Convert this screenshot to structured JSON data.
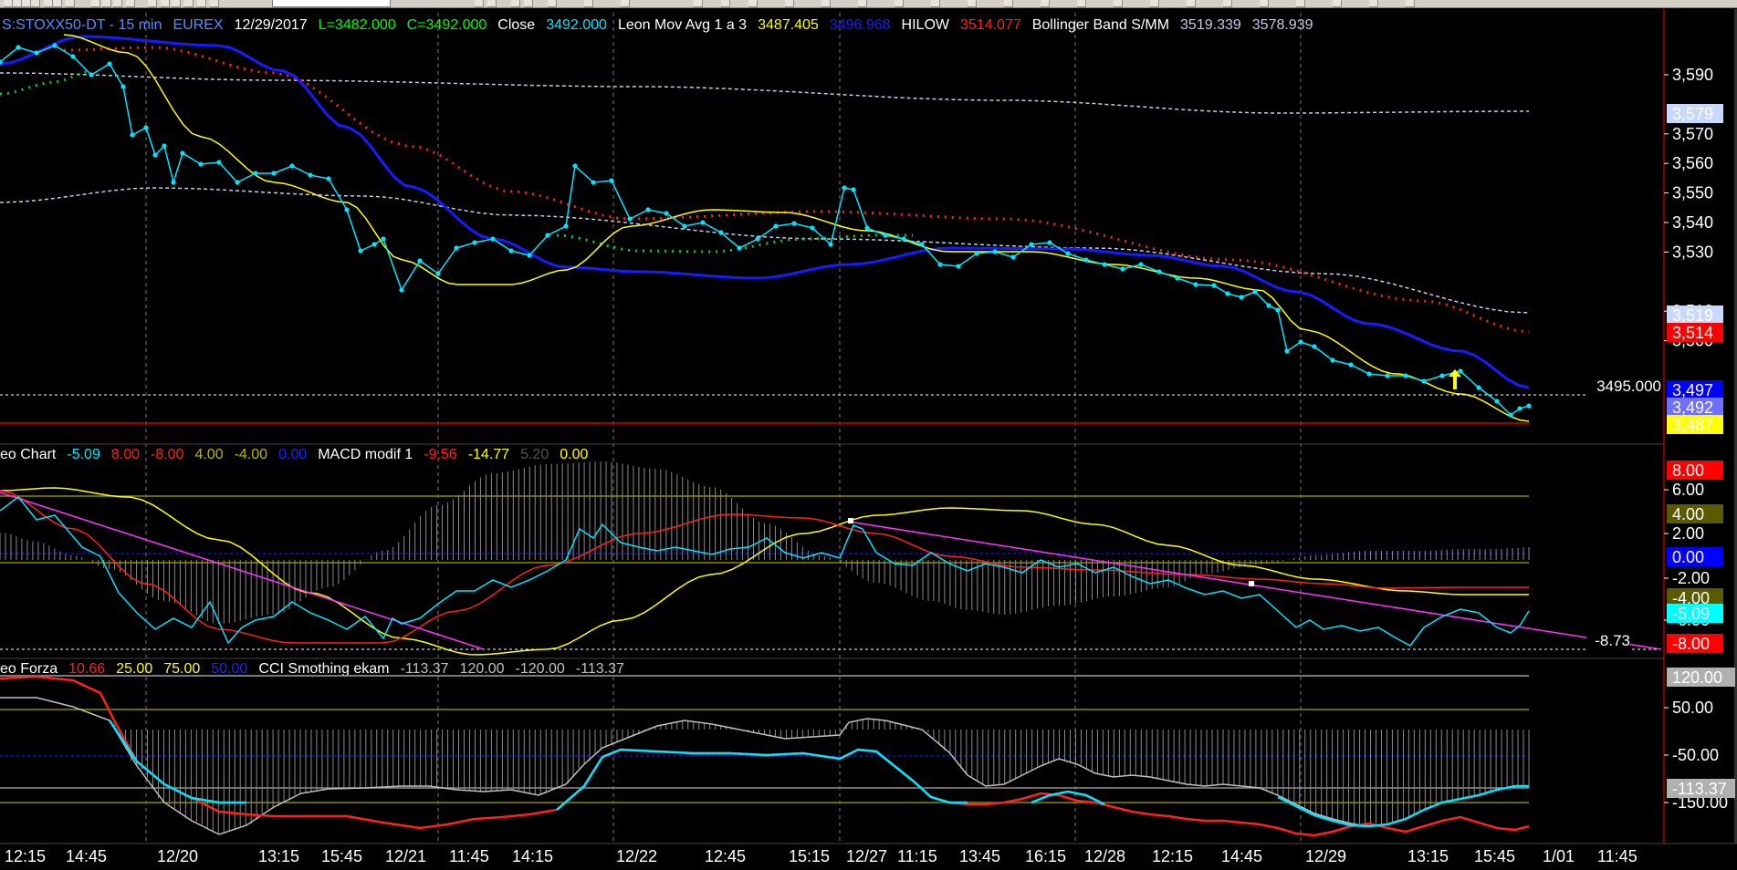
{
  "colors": {
    "background": "#000000",
    "price": "#00e5ff",
    "leon_avg": "#ffff00",
    "hilow": "#1a1aff",
    "bollinger_mid": "#ff2020",
    "bollinger_band": "#c8c8e8",
    "green_dots": "#00cc44",
    "macd_red": "#ff2020",
    "magenta": "#ff33ff",
    "histogram": "#8a8a8a",
    "cci_red": "#ff2020",
    "cci_cyan": "#00e5ff",
    "gray_line": "#c0c0c0"
  },
  "toolbar": {
    "icons": [
      "new-icon",
      "open-icon",
      "save-icon",
      "print-icon",
      "cut-icon",
      "copy-icon",
      "paste-icon",
      "chart-icon",
      "zoom-in-icon",
      "zoom-out-icon",
      "cursor-icon",
      "crosshair-icon",
      "trendline-icon",
      "text-icon"
    ]
  },
  "panel1": {
    "header": [
      {
        "text": "S:STOXX50-DT - 15 min",
        "color": "#5a8cff"
      },
      {
        "text": "EUREX",
        "color": "#5a8cff"
      },
      {
        "text": "12/29/2017",
        "color": "#ffffff"
      },
      {
        "text": "L=3482.000",
        "color": "#00ff00"
      },
      {
        "text": "C=3492.000",
        "color": "#00ff00"
      },
      {
        "text": "Close",
        "color": "#ffffff"
      },
      {
        "text": "3492.000",
        "color": "#00e5ff"
      },
      {
        "text": "Leon Mov Avg 1 a 3",
        "color": "#ffffff"
      },
      {
        "text": "3487.405",
        "color": "#ffff00"
      },
      {
        "text": "3496.968",
        "color": "#1a1aff"
      },
      {
        "text": "HILOW",
        "color": "#ffffff"
      },
      {
        "text": "3514.077",
        "color": "#ff2020"
      },
      {
        "text": "Bollinger Band S/MM",
        "color": "#ffffff"
      },
      {
        "text": "3519.339",
        "color": "#c8c8e8"
      },
      {
        "text": "3578.939",
        "color": "#c8c8e8"
      }
    ],
    "y_ticks": [
      "3,590",
      "3,570",
      "3,560",
      "3,550",
      "3,540",
      "3,530",
      "3,510",
      "3,500"
    ],
    "tags": [
      {
        "text": "3,579",
        "bg": "#c8d8ff",
        "fg": "#000000"
      },
      {
        "text": "3,519",
        "bg": "#c8d8ff",
        "fg": "#000000"
      },
      {
        "text": "3,514",
        "bg": "#ff0000",
        "fg": "#ffffff"
      },
      {
        "text": "3,497",
        "bg": "#0000ff",
        "fg": "#ffffff"
      },
      {
        "text": "3,492",
        "bg": "#7070ff",
        "fg": "#ffffff"
      },
      {
        "text": "3,487",
        "bg": "#ffff00",
        "fg": "#000000"
      }
    ],
    "hline_label": "3495.000"
  },
  "panel2": {
    "header": [
      {
        "text": "eo Chart",
        "color": "#ffffff"
      },
      {
        "text": "-5.09",
        "color": "#00e5ff"
      },
      {
        "text": "8.00",
        "color": "#ff2020"
      },
      {
        "text": "-8.00",
        "color": "#ff2020"
      },
      {
        "text": "4.00",
        "color": "#b8b800"
      },
      {
        "text": "-4.00",
        "color": "#b8b800"
      },
      {
        "text": "0.00",
        "color": "#2020ff"
      },
      {
        "text": "MACD modif 1",
        "color": "#ffffff"
      },
      {
        "text": "-9.56",
        "color": "#ff2020"
      },
      {
        "text": "-14.77",
        "color": "#ffff00"
      },
      {
        "text": "5.20",
        "color": "#555555"
      },
      {
        "text": "0.00",
        "color": "#ffff00"
      }
    ],
    "y_ticks": [
      "6.00",
      "2.00",
      "-2.00",
      "-6.00"
    ],
    "tags": [
      {
        "text": "8.00",
        "bg": "#ff0000",
        "fg": "#ffffff"
      },
      {
        "text": "4.00",
        "bg": "#5a5a00",
        "fg": "#ffffff"
      },
      {
        "text": "0.00",
        "bg": "#0000ff",
        "fg": "#ffffff"
      },
      {
        "text": "-4.00",
        "bg": "#5a5a00",
        "fg": "#ffffff"
      },
      {
        "text": "-5.09",
        "bg": "#00ffff",
        "fg": "#000000"
      },
      {
        "text": "-8.00",
        "bg": "#ff0000",
        "fg": "#ffffff"
      }
    ],
    "hline_label": "-8.73"
  },
  "panel3": {
    "header": [
      {
        "text": "eo Forza",
        "color": "#ffffff"
      },
      {
        "text": "10.66",
        "color": "#ff2020"
      },
      {
        "text": "25.00",
        "color": "#ffff00"
      },
      {
        "text": "75.00",
        "color": "#ffff00"
      },
      {
        "text": "50.00",
        "color": "#2020ff"
      },
      {
        "text": "CCI Smothing ekam",
        "color": "#ffffff"
      },
      {
        "text": "-113.37",
        "color": "#c0c0c0"
      },
      {
        "text": "120.00",
        "color": "#c0c0c0"
      },
      {
        "text": "-120.00",
        "color": "#c0c0c0"
      },
      {
        "text": "-113.37",
        "color": "#c0c0c0"
      }
    ],
    "y_ticks": [
      "50.00",
      "-50.00",
      "-150.00"
    ],
    "tags": [
      {
        "text": "120.00",
        "bg": "#b0b0b0",
        "fg": "#000000"
      },
      {
        "text": "-113.37",
        "bg": "#b0b0b0",
        "fg": "#000000"
      }
    ]
  },
  "x_axis": [
    "12:15",
    "14:45",
    "12/20",
    "13:15",
    "15:45",
    "12/21",
    "11:45",
    "14:15",
    "12/22",
    "12:45",
    "15:15",
    "12/27",
    "11:15",
    "13:45",
    "16:15",
    "12/28",
    "12:15",
    "14:45",
    "12/29",
    "13:15",
    "15:45",
    "1/01",
    "11:45"
  ],
  "chart_data": [
    {
      "type": "line",
      "x": [
        "12/19 12:15",
        "12/19 14:45",
        "12/20",
        "12/20 13:15",
        "12/20 15:45",
        "12/21",
        "12/21 11:45",
        "12/21 14:15",
        "12/22",
        "12/22 12:45",
        "12/22 15:15",
        "12/27",
        "12/27 11:15",
        "12/27 13:45",
        "12/27 16:15",
        "12/28",
        "12/28 12:15",
        "12/28 14:45",
        "12/29",
        "12/29 13:15",
        "12/29 15:45"
      ],
      "series": [
        {
          "name": "Close",
          "values": [
            3597,
            3590,
            3562,
            3560,
            3555,
            3526,
            3538,
            3540,
            3555,
            3545,
            3547,
            3556,
            3545,
            3535,
            3540,
            3532,
            3530,
            3525,
            3508,
            3498,
            3490
          ]
        },
        {
          "name": "Leon Mov Avg 1 a 3",
          "values": [
            3600,
            3595,
            3570,
            3563,
            3550,
            3528,
            3530,
            3540,
            3548,
            3550,
            3549,
            3548,
            3542,
            3538,
            3537,
            3533,
            3530,
            3525,
            3515,
            3500,
            3487
          ]
        },
        {
          "name": "HILOW",
          "values": [
            3601,
            3600,
            3590,
            3585,
            3575,
            3545,
            3532,
            3530,
            3530,
            3530,
            3531,
            3534,
            3537,
            3538,
            3537,
            3536,
            3533,
            3528,
            3520,
            3508,
            3497
          ]
        },
        {
          "name": "Bollinger Band S/MM",
          "values": [
            3600,
            3599,
            3597,
            3590,
            3580,
            3565,
            3556,
            3550,
            3550,
            3550,
            3551,
            3551,
            3549,
            3548,
            3546,
            3543,
            3540,
            3535,
            3530,
            3522,
            3514
          ]
        }
      ],
      "ylim": [
        3484,
        3602
      ]
    },
    {
      "type": "line",
      "series": [
        {
          "name": "MACD modif 1",
          "values": [
            5,
            2,
            -1,
            -3,
            -5,
            -6,
            -3,
            1,
            4,
            5,
            5,
            3,
            0,
            -1,
            -1,
            -1,
            -2,
            -3,
            -4,
            -5
          ]
        },
        {
          "name": "Leon Chart",
          "values": [
            6,
            2,
            -6,
            -7,
            -5,
            -6,
            -3,
            1,
            0,
            -1,
            -1,
            3,
            -1,
            -1,
            -1,
            -2,
            -2,
            -4,
            -6,
            -5
          ]
        }
      ],
      "ylim": [
        -9,
        9
      ]
    },
    {
      "type": "line",
      "series": [
        {
          "name": "Leon Forza",
          "values": [
            120,
            110,
            -120,
            -130,
            -140,
            -120,
            -110,
            -50,
            -50,
            -55,
            -60,
            -80,
            -120,
            -130,
            -135,
            -140,
            -140,
            -138,
            -125,
            -120
          ]
        },
        {
          "name": "CCI Smothing ekam",
          "values": [
            100,
            80,
            -130,
            -120,
            -100,
            -90,
            -40,
            20,
            40,
            25,
            20,
            40,
            0,
            -50,
            -30,
            -50,
            -60,
            -90,
            -130,
            -113
          ]
        }
      ],
      "ylim": [
        -160,
        130
      ]
    }
  ]
}
